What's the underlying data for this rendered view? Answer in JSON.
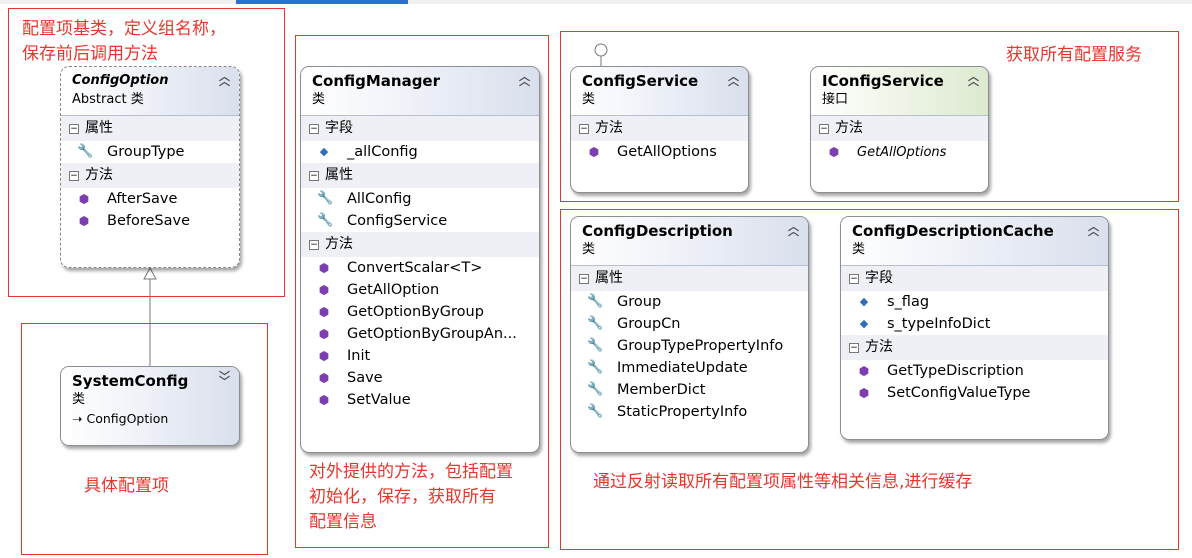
{
  "annotations": {
    "base_class_note": "配置项基类，定义组名称，\n保存前后调用方法",
    "concrete_note": "具体配置项",
    "manager_note": "对外提供的方法，包括配置\n初始化，保存，获取所有\n配置信息",
    "service_note": "获取所有配置服务",
    "description_note": "通过反射读取所有配置项属性等相关信息,进行缓存"
  },
  "classes": {
    "config_option": {
      "name": "ConfigOption",
      "kind": "Abstract 类",
      "sections": [
        {
          "label": "属性",
          "items": [
            {
              "text": "GroupType",
              "icon": "wrench-icon"
            }
          ]
        },
        {
          "label": "方法",
          "items": [
            {
              "text": "AfterSave",
              "icon": "method-icon"
            },
            {
              "text": "BeforeSave",
              "icon": "method-icon"
            }
          ]
        }
      ]
    },
    "system_config": {
      "name": "SystemConfig",
      "kind": "类",
      "base": "ConfigOption"
    },
    "config_manager": {
      "name": "ConfigManager",
      "kind": "类",
      "sections": [
        {
          "label": "字段",
          "items": [
            {
              "text": "_allConfig",
              "icon": "private-field-icon"
            }
          ]
        },
        {
          "label": "属性",
          "items": [
            {
              "text": "AllConfig",
              "icon": "wrench-icon"
            },
            {
              "text": "ConfigService",
              "icon": "wrench-icon"
            }
          ]
        },
        {
          "label": "方法",
          "items": [
            {
              "text": "ConvertScalar<T>",
              "icon": "private-method-icon"
            },
            {
              "text": "GetAllOption",
              "icon": "method-icon"
            },
            {
              "text": "GetOptionByGroup",
              "icon": "method-icon"
            },
            {
              "text": "GetOptionByGroupAn...",
              "icon": "method-icon"
            },
            {
              "text": "Init",
              "icon": "method-icon"
            },
            {
              "text": "Save",
              "icon": "method-icon"
            },
            {
              "text": "SetValue",
              "icon": "method-icon"
            }
          ]
        }
      ]
    },
    "config_service": {
      "name": "ConfigService",
      "kind": "类",
      "sections": [
        {
          "label": "方法",
          "items": [
            {
              "text": "GetAllOptions",
              "icon": "method-icon"
            }
          ]
        }
      ]
    },
    "iconfig_service": {
      "name": "IConfigService",
      "kind": "接口",
      "sections": [
        {
          "label": "方法",
          "items": [
            {
              "text": "GetAllOptions",
              "icon": "method-icon"
            }
          ]
        }
      ]
    },
    "config_description": {
      "name": "ConfigDescription",
      "kind": "类",
      "sections": [
        {
          "label": "属性",
          "items": [
            {
              "text": "Group",
              "icon": "wrench-icon"
            },
            {
              "text": "GroupCn",
              "icon": "wrench-icon"
            },
            {
              "text": "GroupTypePropertyInfo",
              "icon": "wrench-icon"
            },
            {
              "text": "ImmediateUpdate",
              "icon": "wrench-icon"
            },
            {
              "text": "MemberDict",
              "icon": "wrench-icon"
            },
            {
              "text": "StaticPropertyInfo",
              "icon": "wrench-icon"
            }
          ]
        }
      ]
    },
    "config_description_cache": {
      "name": "ConfigDescriptionCache",
      "kind": "类",
      "sections": [
        {
          "label": "字段",
          "items": [
            {
              "text": "s_flag",
              "icon": "private-field-icon"
            },
            {
              "text": "s_typeInfoDict",
              "icon": "private-field-icon"
            }
          ]
        },
        {
          "label": "方法",
          "items": [
            {
              "text": "GetTypeDiscription",
              "icon": "method-icon"
            },
            {
              "text": "SetConfigValueType",
              "icon": "private-method-icon"
            }
          ]
        }
      ]
    }
  },
  "colors": {
    "annotation": "#e8362d",
    "class_header": "#d9dfec",
    "interface_header": "#dde9cf"
  }
}
